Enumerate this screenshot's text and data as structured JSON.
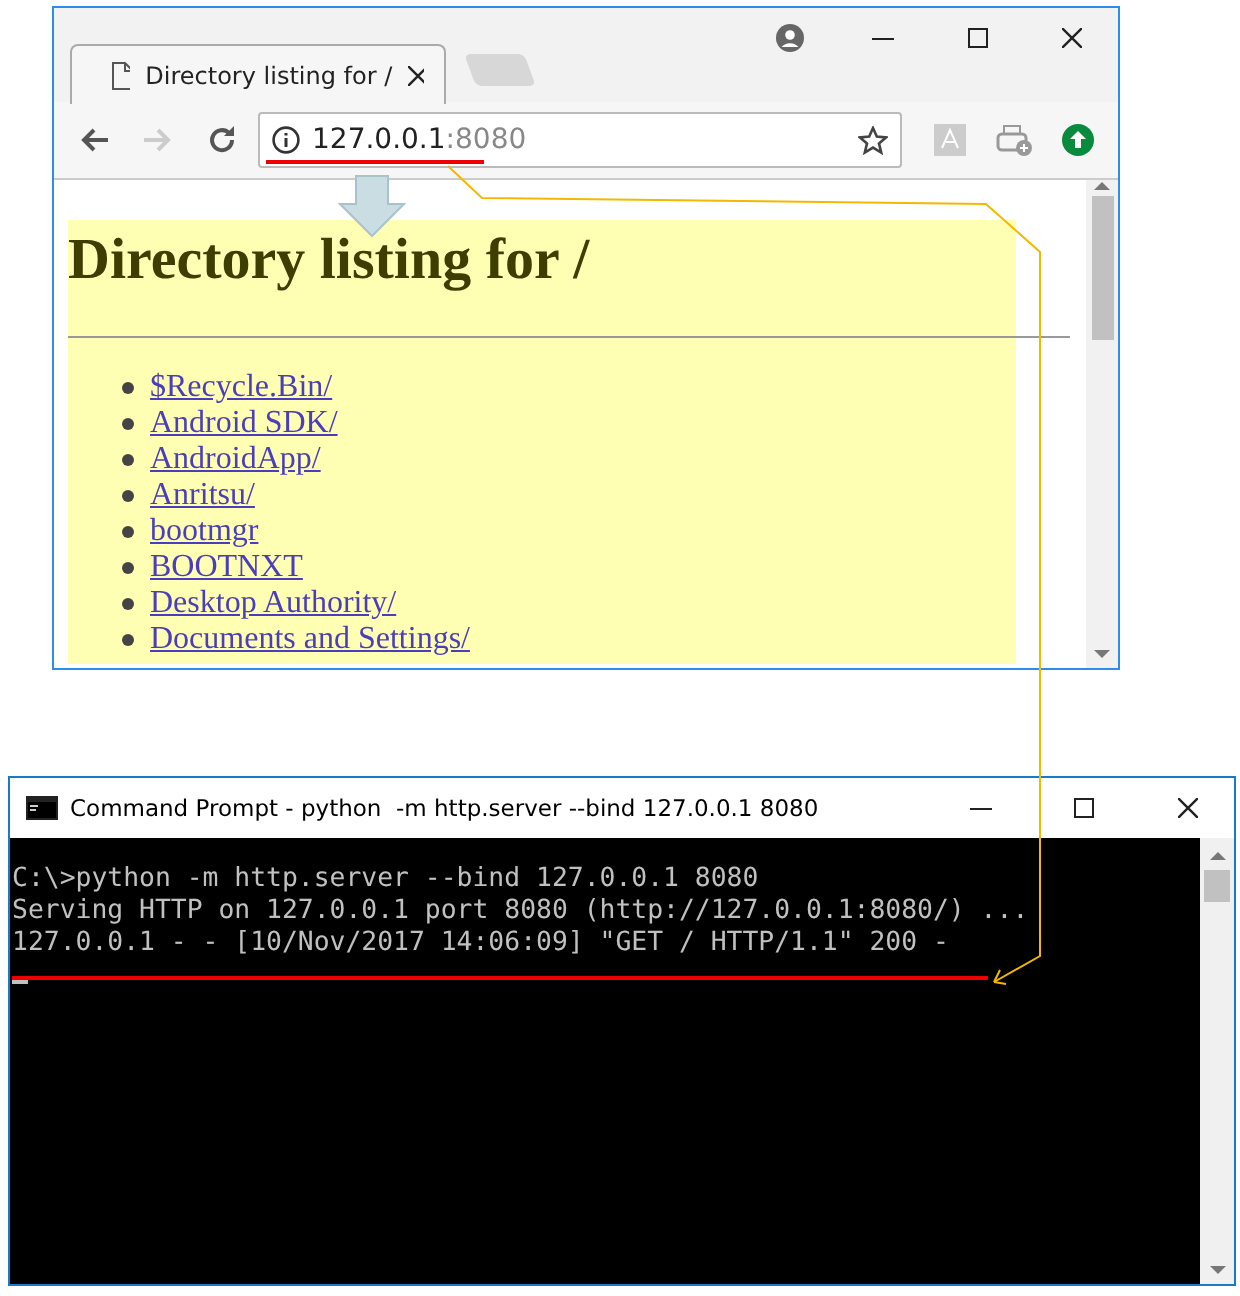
{
  "browser": {
    "tab_title": "Directory listing for /",
    "address": {
      "host": "127.0.0.1",
      "port": ":8080"
    },
    "page": {
      "heading": "Directory listing for /",
      "links": [
        "$Recycle.Bin/",
        "Android SDK/",
        "AndroidApp/",
        "Anritsu/",
        "bootmgr",
        "BOOTNXT",
        "Desktop Authority/",
        "Documents and Settings/"
      ]
    }
  },
  "console": {
    "title": "Command Prompt - python  -m http.server --bind 127.0.0.1 8080",
    "lines": [
      "C:\\>python -m http.server --bind 127.0.0.1 8080",
      "Serving HTTP on 127.0.0.1 port 8080 (http://127.0.0.1:8080/) ...",
      "127.0.0.1 - - [10/Nov/2017 14:06:09] \"GET / HTTP/1.1\" 200 -"
    ]
  }
}
